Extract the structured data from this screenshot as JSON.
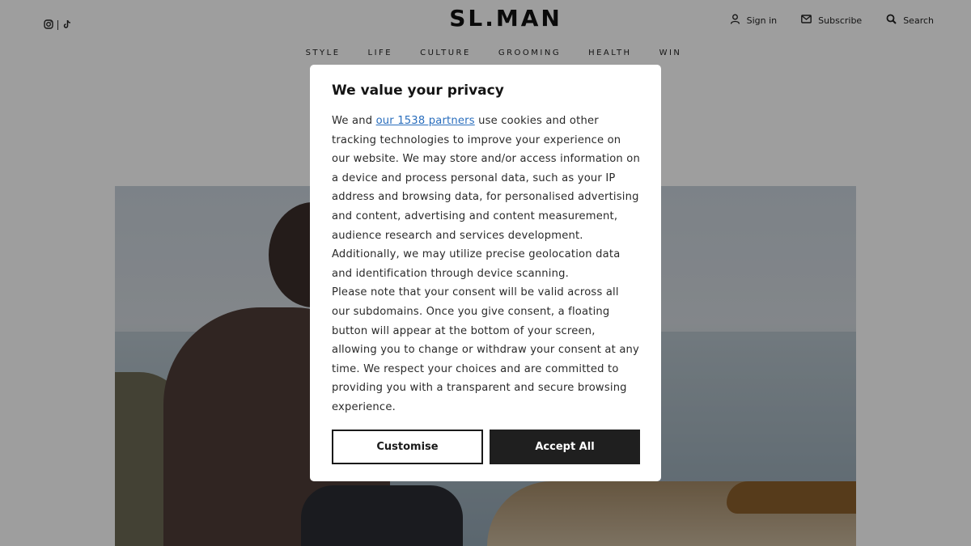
{
  "header": {
    "logo": "SL.MAN",
    "actions": [
      {
        "label": "Sign in",
        "icon": "user-icon"
      },
      {
        "label": "Subscribe",
        "icon": "envelope-icon"
      },
      {
        "label": "Search",
        "icon": "search-icon"
      }
    ],
    "social": [
      "instagram-icon",
      "tiktok-icon"
    ]
  },
  "nav": {
    "items": [
      "STYLE",
      "LIFE",
      "CULTURE",
      "GROOMING",
      "HEALTH",
      "WIN"
    ]
  },
  "privacy_modal": {
    "title": "We value your privacy",
    "intro_before_link": "We and ",
    "partners_link": "our 1538 partners",
    "paragraph_1_rest": " use cookies and other tracking technologies to improve your experience on our website. We may store and/or access information on a device and process personal data, such as your IP address and browsing data, for personalised advertising and content, advertising and content measurement, audience research and services development. Additionally, we may utilize precise geolocation data and identification through device scanning.",
    "paragraph_2": "Please note that your consent will be valid across all our subdomains. Once you give consent, a floating button will appear at the bottom of your screen, allowing you to change or withdraw your consent at any time. We respect your choices and are committed to providing you with a transparent and secure browsing experience.",
    "customise_label": "Customise",
    "accept_label": "Accept All"
  },
  "colors": {
    "overlay": "rgba(0,0,0,0.38)",
    "link": "#2a6ebd",
    "accept_bg": "#1f1f1f"
  }
}
